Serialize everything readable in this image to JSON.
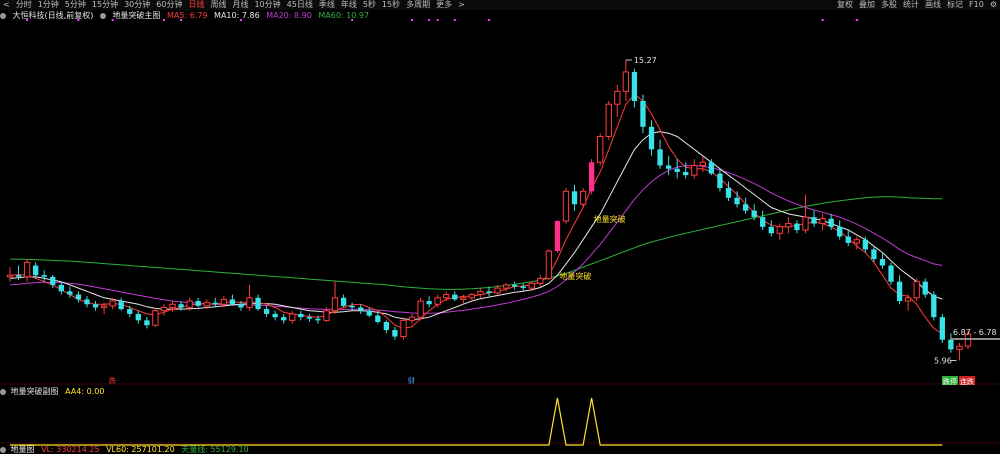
{
  "toolbar": {
    "arrow": "<",
    "periods": [
      "分时",
      "1分钟",
      "5分钟",
      "15分钟",
      "30分钟",
      "60分钟",
      "日线",
      "周线",
      "月线",
      "10分钟",
      "45日线",
      "季线",
      "年线",
      "5秒",
      "15秒",
      "多周期",
      "更多"
    ],
    "active_index": 6,
    "more_arrow": ">",
    "right_items": [
      "复权",
      "叠加",
      "多股",
      "统计",
      "画线",
      "标记",
      "F10",
      "⚙"
    ]
  },
  "main_legend": {
    "stock": "大恒科技(日线,前复权)",
    "indicator": "地量突破主图",
    "ma5": "MA5: 6.79",
    "ma10": "MA10: 7.86",
    "ma20": "MA20: 8.90",
    "ma60": "MA60: 10.97"
  },
  "sub_legend": {
    "name": "地量突破副图",
    "aa4": "AA4: 0.00"
  },
  "bottom_legend": {
    "name": "地量图",
    "vl": "VL: 330214.25",
    "vl60": "VL60: 257101.20",
    "tianliang": "天量线: 55129.10"
  },
  "annotations": {
    "high_label": "15.27",
    "signal_label_1": "地量突破",
    "signal_label_2": "地量突破",
    "price_line_label": "6.87 - 6.78",
    "low_label": "5.96",
    "event_tag": "跌",
    "cai_marker": "财",
    "tag_badge_1": "跌停",
    "tag_badge_2": "连跌"
  },
  "colors": {
    "up": "#ff3c3c",
    "down": "#37e3e8",
    "ma5": "#ff3c3c",
    "ma10": "#e8e8e8",
    "ma20": "#c23bd4",
    "ma60": "#2fb03a",
    "signal_bar": "#ff2f8a",
    "yellow": "#ffe32a",
    "purple_marks": "#ff3cff"
  },
  "chart_data": {
    "type": "candlestick",
    "price_range": [
      5.6,
      16.2
    ],
    "candles": [
      [
        8.55,
        8.85,
        8.4,
        8.6
      ],
      [
        8.6,
        8.9,
        8.45,
        8.55
      ],
      [
        8.55,
        9.1,
        8.4,
        9.0
      ],
      [
        8.9,
        9.0,
        8.5,
        8.6
      ],
      [
        8.6,
        8.75,
        8.4,
        8.55
      ],
      [
        8.55,
        8.6,
        8.2,
        8.3
      ],
      [
        8.3,
        8.4,
        8.0,
        8.1
      ],
      [
        8.1,
        8.25,
        7.9,
        8.0
      ],
      [
        8.0,
        8.1,
        7.75,
        7.85
      ],
      [
        7.85,
        7.95,
        7.6,
        7.7
      ],
      [
        7.7,
        7.8,
        7.5,
        7.6
      ],
      [
        7.6,
        7.75,
        7.4,
        7.65
      ],
      [
        7.65,
        7.9,
        7.55,
        7.8
      ],
      [
        7.8,
        7.9,
        7.5,
        7.55
      ],
      [
        7.55,
        7.65,
        7.3,
        7.4
      ],
      [
        7.4,
        7.5,
        7.1,
        7.2
      ],
      [
        7.2,
        7.3,
        6.95,
        7.05
      ],
      [
        7.05,
        7.6,
        7.0,
        7.5
      ],
      [
        7.5,
        7.7,
        7.35,
        7.6
      ],
      [
        7.6,
        7.8,
        7.45,
        7.7
      ],
      [
        7.7,
        7.8,
        7.5,
        7.6
      ],
      [
        7.6,
        7.9,
        7.5,
        7.8
      ],
      [
        7.8,
        7.9,
        7.6,
        7.65
      ],
      [
        7.65,
        7.85,
        7.55,
        7.75
      ],
      [
        7.75,
        7.9,
        7.6,
        7.7
      ],
      [
        7.7,
        7.95,
        7.6,
        7.85
      ],
      [
        7.85,
        8.0,
        7.65,
        7.7
      ],
      [
        7.7,
        7.8,
        7.5,
        7.6
      ],
      [
        7.6,
        8.3,
        7.5,
        7.9
      ],
      [
        7.9,
        8.0,
        7.5,
        7.55
      ],
      [
        7.55,
        7.65,
        7.3,
        7.4
      ],
      [
        7.4,
        7.5,
        7.2,
        7.3
      ],
      [
        7.3,
        7.4,
        7.1,
        7.2
      ],
      [
        7.2,
        7.5,
        7.1,
        7.4
      ],
      [
        7.4,
        7.5,
        7.2,
        7.3
      ],
      [
        7.3,
        7.4,
        7.15,
        7.25
      ],
      [
        7.25,
        7.35,
        7.1,
        7.2
      ],
      [
        7.2,
        7.6,
        7.15,
        7.5
      ],
      [
        7.5,
        8.4,
        7.4,
        7.9
      ],
      [
        7.9,
        8.0,
        7.6,
        7.65
      ],
      [
        7.65,
        7.75,
        7.5,
        7.6
      ],
      [
        7.6,
        7.7,
        7.4,
        7.5
      ],
      [
        7.5,
        7.6,
        7.3,
        7.35
      ],
      [
        7.35,
        7.45,
        7.1,
        7.15
      ],
      [
        7.15,
        7.2,
        6.8,
        6.9
      ],
      [
        6.9,
        7.0,
        6.6,
        6.7
      ],
      [
        6.7,
        7.3,
        6.6,
        7.2
      ],
      [
        7.2,
        7.4,
        7.1,
        7.3
      ],
      [
        7.3,
        7.9,
        7.2,
        7.8
      ],
      [
        7.8,
        7.95,
        7.6,
        7.7
      ],
      [
        7.7,
        8.0,
        7.6,
        7.9
      ],
      [
        7.9,
        8.1,
        7.8,
        8.0
      ],
      [
        8.0,
        8.1,
        7.8,
        7.85
      ],
      [
        7.85,
        8.0,
        7.7,
        7.9
      ],
      [
        7.9,
        8.05,
        7.8,
        8.0
      ],
      [
        8.0,
        8.2,
        7.9,
        8.1
      ],
      [
        8.1,
        8.25,
        7.95,
        8.05
      ],
      [
        8.05,
        8.3,
        8.0,
        8.2
      ],
      [
        8.2,
        8.35,
        8.1,
        8.3
      ],
      [
        8.3,
        8.4,
        8.15,
        8.25
      ],
      [
        8.25,
        8.35,
        8.1,
        8.2
      ],
      [
        8.2,
        8.4,
        8.1,
        8.35
      ],
      [
        8.35,
        8.6,
        8.25,
        8.5
      ],
      [
        8.5,
        9.4,
        8.45,
        9.35
      ],
      [
        9.35,
        10.3,
        9.3,
        10.28
      ],
      [
        10.28,
        11.3,
        10.2,
        11.2
      ],
      [
        11.2,
        11.4,
        10.6,
        10.8
      ],
      [
        10.8,
        11.3,
        10.7,
        11.2
      ],
      [
        11.2,
        12.2,
        11.1,
        12.1
      ],
      [
        12.1,
        13.0,
        12.0,
        12.9
      ],
      [
        12.9,
        14.0,
        12.8,
        13.9
      ],
      [
        13.9,
        14.5,
        13.5,
        14.3
      ],
      [
        14.3,
        15.27,
        14.0,
        14.9
      ],
      [
        14.9,
        15.0,
        13.8,
        14.0
      ],
      [
        14.0,
        14.2,
        13.0,
        13.2
      ],
      [
        13.2,
        13.4,
        12.3,
        12.5
      ],
      [
        12.5,
        12.8,
        11.9,
        12.0
      ],
      [
        12.0,
        12.3,
        11.7,
        11.9
      ],
      [
        11.9,
        12.2,
        11.6,
        11.8
      ],
      [
        11.8,
        12.1,
        11.6,
        11.7
      ],
      [
        11.7,
        12.2,
        11.6,
        12.0
      ],
      [
        12.0,
        12.3,
        11.8,
        12.1
      ],
      [
        12.1,
        12.2,
        11.7,
        11.75
      ],
      [
        11.75,
        11.9,
        11.2,
        11.3
      ],
      [
        11.3,
        11.5,
        10.9,
        11.0
      ],
      [
        11.0,
        11.2,
        10.7,
        10.8
      ],
      [
        10.8,
        11.0,
        10.5,
        10.6
      ],
      [
        10.6,
        10.8,
        10.3,
        10.4
      ],
      [
        10.4,
        10.6,
        10.0,
        10.1
      ],
      [
        10.1,
        10.3,
        9.8,
        9.9
      ],
      [
        9.9,
        10.2,
        9.7,
        10.1
      ],
      [
        10.1,
        10.4,
        9.9,
        10.2
      ],
      [
        10.2,
        10.3,
        9.9,
        10.0
      ],
      [
        10.0,
        11.1,
        9.9,
        10.4
      ],
      [
        10.4,
        10.6,
        10.1,
        10.2
      ],
      [
        10.2,
        10.5,
        10.0,
        10.35
      ],
      [
        10.35,
        10.5,
        10.0,
        10.1
      ],
      [
        10.1,
        10.3,
        9.7,
        9.8
      ],
      [
        9.8,
        10.0,
        9.5,
        9.6
      ],
      [
        9.6,
        9.8,
        9.4,
        9.7
      ],
      [
        9.7,
        9.8,
        9.3,
        9.4
      ],
      [
        9.4,
        9.5,
        9.0,
        9.1
      ],
      [
        9.1,
        9.3,
        8.8,
        8.9
      ],
      [
        8.9,
        9.0,
        8.3,
        8.4
      ],
      [
        8.4,
        8.6,
        7.7,
        7.8
      ],
      [
        7.8,
        8.0,
        7.5,
        7.9
      ],
      [
        7.9,
        8.5,
        7.8,
        8.4
      ],
      [
        8.4,
        8.5,
        7.9,
        8.0
      ],
      [
        8.0,
        8.1,
        7.2,
        7.3
      ],
      [
        7.3,
        7.4,
        6.5,
        6.6
      ],
      [
        6.6,
        6.8,
        6.2,
        6.3
      ],
      [
        6.3,
        6.5,
        5.96,
        6.4
      ],
      [
        6.4,
        6.87,
        6.3,
        6.78
      ]
    ],
    "ma5": [
      8.6,
      8.62,
      8.6,
      8.5,
      8.4,
      8.3,
      8.15,
      8.0,
      7.85,
      7.75,
      7.7,
      7.7,
      7.72,
      7.7,
      7.6,
      7.5,
      7.4,
      7.38,
      7.45,
      7.55,
      7.6,
      7.68,
      7.7,
      7.72,
      7.7,
      7.75,
      7.78,
      7.75,
      7.78,
      7.75,
      7.7,
      7.6,
      7.45,
      7.4,
      7.35,
      7.32,
      7.3,
      7.35,
      7.5,
      7.6,
      7.68,
      7.7,
      7.6,
      7.5,
      7.3,
      7.05,
      6.95,
      7.0,
      7.25,
      7.5,
      7.7,
      7.85,
      7.9,
      7.95,
      7.95,
      8.0,
      8.05,
      8.1,
      8.17,
      8.25,
      8.27,
      8.3,
      8.4,
      8.6,
      9.1,
      9.7,
      10.2,
      10.7,
      11.3,
      11.8,
      12.5,
      13.2,
      13.9,
      14.2,
      14.0,
      13.6,
      13.1,
      12.6,
      12.2,
      11.95,
      11.9,
      11.9,
      11.8,
      11.6,
      11.35,
      11.1,
      10.8,
      10.55,
      10.3,
      10.15,
      10.1,
      10.1,
      10.15,
      10.2,
      10.25,
      10.2,
      10.1,
      9.95,
      9.75,
      9.5,
      9.3,
      9.0,
      8.6,
      8.2,
      8.0,
      7.95,
      7.7,
      7.3,
      6.95,
      6.79
    ],
    "ma10": [
      8.5,
      8.52,
      8.55,
      8.55,
      8.5,
      8.45,
      8.4,
      8.3,
      8.2,
      8.1,
      8.0,
      7.9,
      7.85,
      7.8,
      7.75,
      7.7,
      7.62,
      7.57,
      7.55,
      7.55,
      7.55,
      7.56,
      7.57,
      7.6,
      7.62,
      7.65,
      7.68,
      7.7,
      7.72,
      7.72,
      7.72,
      7.7,
      7.65,
      7.6,
      7.55,
      7.5,
      7.48,
      7.45,
      7.45,
      7.47,
      7.5,
      7.5,
      7.48,
      7.45,
      7.4,
      7.3,
      7.25,
      7.22,
      7.25,
      7.3,
      7.4,
      7.5,
      7.6,
      7.7,
      7.8,
      7.87,
      7.92,
      7.97,
      8.02,
      8.07,
      8.1,
      8.15,
      8.22,
      8.35,
      8.6,
      8.95,
      9.3,
      9.7,
      10.1,
      10.5,
      11.0,
      11.5,
      12.0,
      12.5,
      12.8,
      13.0,
      13.05,
      13.0,
      12.9,
      12.7,
      12.5,
      12.3,
      12.1,
      11.9,
      11.7,
      11.5,
      11.3,
      11.1,
      10.9,
      10.7,
      10.6,
      10.5,
      10.45,
      10.4,
      10.35,
      10.3,
      10.2,
      10.1,
      10.0,
      9.85,
      9.7,
      9.5,
      9.3,
      9.05,
      8.8,
      8.6,
      8.4,
      8.15,
      7.95,
      7.86
    ],
    "ma20": [
      8.3,
      8.32,
      8.35,
      8.37,
      8.38,
      8.38,
      8.37,
      8.35,
      8.32,
      8.28,
      8.23,
      8.18,
      8.13,
      8.08,
      8.03,
      7.98,
      7.93,
      7.88,
      7.84,
      7.8,
      7.77,
      7.75,
      7.73,
      7.71,
      7.7,
      7.69,
      7.68,
      7.68,
      7.68,
      7.67,
      7.66,
      7.64,
      7.62,
      7.6,
      7.58,
      7.56,
      7.55,
      7.54,
      7.54,
      7.54,
      7.54,
      7.54,
      7.53,
      7.52,
      7.5,
      7.47,
      7.45,
      7.43,
      7.42,
      7.42,
      7.43,
      7.45,
      7.48,
      7.51,
      7.55,
      7.59,
      7.63,
      7.68,
      7.73,
      7.79,
      7.85,
      7.92,
      8.0,
      8.1,
      8.25,
      8.45,
      8.7,
      8.95,
      9.25,
      9.55,
      9.9,
      10.25,
      10.6,
      10.95,
      11.25,
      11.5,
      11.7,
      11.85,
      11.95,
      12.0,
      12.0,
      11.98,
      11.93,
      11.86,
      11.78,
      11.68,
      11.56,
      11.44,
      11.3,
      11.15,
      11.02,
      10.9,
      10.8,
      10.7,
      10.62,
      10.55,
      10.48,
      10.4,
      10.3,
      10.18,
      10.05,
      9.9,
      9.75,
      9.58,
      9.4,
      9.25,
      9.15,
      9.05,
      8.95,
      8.9
    ],
    "ma60": [
      9.1,
      9.1,
      9.09,
      9.08,
      9.07,
      9.06,
      9.05,
      9.04,
      9.02,
      9.0,
      8.98,
      8.96,
      8.94,
      8.92,
      8.9,
      8.88,
      8.86,
      8.84,
      8.82,
      8.8,
      8.78,
      8.76,
      8.74,
      8.72,
      8.7,
      8.68,
      8.66,
      8.64,
      8.62,
      8.6,
      8.58,
      8.56,
      8.54,
      8.52,
      8.5,
      8.48,
      8.46,
      8.44,
      8.42,
      8.4,
      8.38,
      8.36,
      8.34,
      8.32,
      8.3,
      8.27,
      8.24,
      8.22,
      8.2,
      8.18,
      8.17,
      8.16,
      8.16,
      8.17,
      8.18,
      8.2,
      8.22,
      8.25,
      8.28,
      8.32,
      8.36,
      8.4,
      8.45,
      8.5,
      8.58,
      8.66,
      8.75,
      8.85,
      8.95,
      9.05,
      9.15,
      9.25,
      9.35,
      9.45,
      9.55,
      9.63,
      9.7,
      9.77,
      9.84,
      9.9,
      9.96,
      10.02,
      10.08,
      10.14,
      10.2,
      10.26,
      10.32,
      10.38,
      10.44,
      10.5,
      10.56,
      10.62,
      10.68,
      10.73,
      10.78,
      10.83,
      10.87,
      10.91,
      10.94,
      10.97,
      11.0,
      11.02,
      11.03,
      11.03,
      11.02,
      11.0,
      10.99,
      10.98,
      10.97,
      10.97
    ],
    "signal_indices": [
      64,
      68
    ],
    "aa4": [
      0,
      0,
      0,
      0,
      0,
      0,
      0,
      0,
      0,
      0,
      0,
      0,
      0,
      0,
      0,
      0,
      0,
      0,
      0,
      0,
      0,
      0,
      0,
      0,
      0,
      0,
      0,
      0,
      0,
      0,
      0,
      0,
      0,
      0,
      0,
      0,
      0,
      0,
      0,
      0,
      0,
      0,
      0,
      0,
      0,
      0,
      0,
      0,
      0,
      0,
      0,
      0,
      0,
      0,
      0,
      0,
      0,
      0,
      0,
      0,
      0,
      0,
      0,
      0,
      1,
      0,
      0,
      0,
      1,
      0,
      0,
      0,
      0,
      0,
      0,
      0,
      0,
      0,
      0,
      0,
      0,
      0,
      0,
      0,
      0,
      0,
      0,
      0,
      0,
      0,
      0,
      0,
      0,
      0,
      0,
      0,
      0,
      0,
      0,
      0,
      0,
      0,
      0,
      0,
      0,
      0,
      0,
      0,
      0,
      0
    ],
    "aa4_range": [
      0,
      1
    ],
    "price_line": 6.87,
    "marker_indices": [
      2,
      8,
      12,
      18,
      20,
      27,
      40,
      47,
      49,
      50,
      52,
      56,
      95,
      99
    ]
  }
}
